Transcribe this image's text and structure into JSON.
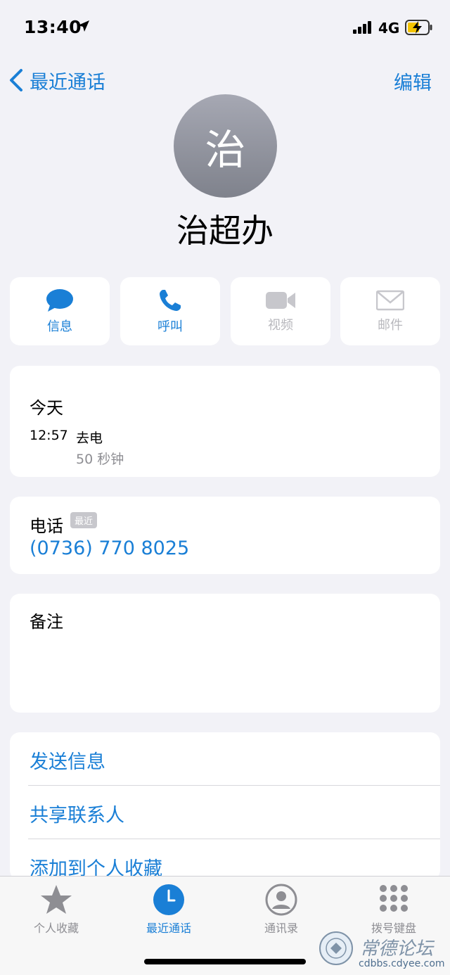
{
  "status_bar": {
    "time": "13:40",
    "network": "4G"
  },
  "nav": {
    "back_label": "最近通话",
    "edit_label": "编辑"
  },
  "contact": {
    "avatar_initial": "治",
    "name": "治超办"
  },
  "actions": [
    {
      "label": "信息",
      "icon": "message-icon",
      "enabled": true
    },
    {
      "label": "呼叫",
      "icon": "phone-icon",
      "enabled": true
    },
    {
      "label": "视频",
      "icon": "video-icon",
      "enabled": false
    },
    {
      "label": "邮件",
      "icon": "mail-icon",
      "enabled": false
    }
  ],
  "call_log": {
    "date": "今天",
    "time": "12:57",
    "type": "去电",
    "duration": "50 秒钟"
  },
  "phone": {
    "label": "电话",
    "badge": "最近",
    "number": "(0736) 770 8025"
  },
  "notes": {
    "label": "备注"
  },
  "options": [
    "发送信息",
    "共享联系人",
    "添加到个人收藏"
  ],
  "tabs": [
    {
      "label": "个人收藏",
      "icon": "star-icon",
      "active": false
    },
    {
      "label": "最近通话",
      "icon": "clock-icon",
      "active": true
    },
    {
      "label": "通讯录",
      "icon": "contacts-icon",
      "active": false
    },
    {
      "label": "拨号键盘",
      "icon": "keypad-icon",
      "active": false
    }
  ],
  "watermark": {
    "text": "常德论坛",
    "url": "cdbbs.cdyee.com"
  },
  "colors": {
    "accent": "#1a7fd6",
    "disabled": "#b7b7bc",
    "background": "#f2f2f7"
  }
}
